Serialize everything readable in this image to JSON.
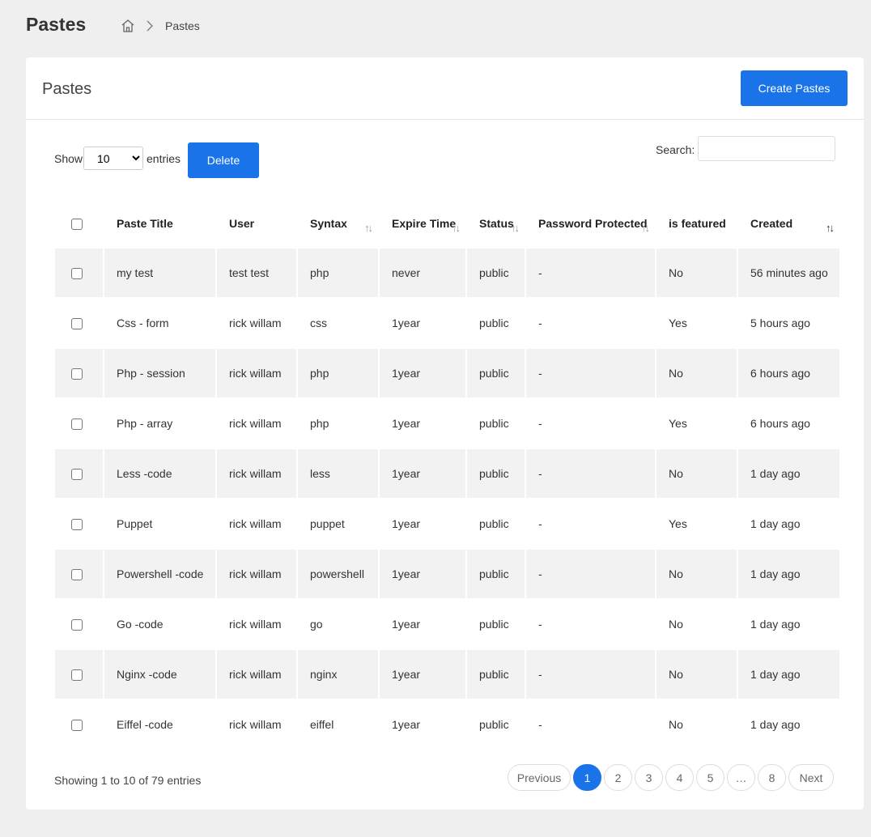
{
  "header": {
    "title": "Pastes",
    "breadcrumb_current": "Pastes"
  },
  "card": {
    "title": "Pastes",
    "create_label": "Create Pastes"
  },
  "controls": {
    "show_label": "Show",
    "length_value": "10",
    "entries_label": "entries",
    "delete_label": "Delete",
    "search_label": "Search:",
    "search_value": ""
  },
  "table": {
    "columns": [
      "Paste Title",
      "User",
      "Syntax",
      "Expire Time",
      "Status",
      "Password Protected",
      "is featured",
      "Created"
    ],
    "rows": [
      [
        "my test",
        "test test",
        "php",
        "never",
        "public",
        "-",
        "No",
        "56 minutes ago"
      ],
      [
        "Css - form",
        "rick willam",
        "css",
        "1year",
        "public",
        "-",
        "Yes",
        "5 hours ago"
      ],
      [
        "Php - session",
        "rick willam",
        "php",
        "1year",
        "public",
        "-",
        "No",
        "6 hours ago"
      ],
      [
        "Php - array",
        "rick willam",
        "php",
        "1year",
        "public",
        "-",
        "Yes",
        "6 hours ago"
      ],
      [
        "Less -code",
        "rick willam",
        "less",
        "1year",
        "public",
        "-",
        "No",
        "1 day ago"
      ],
      [
        "Puppet",
        "rick willam",
        "puppet",
        "1year",
        "public",
        "-",
        "Yes",
        "1 day ago"
      ],
      [
        "Powershell -code",
        "rick willam",
        "powershell",
        "1year",
        "public",
        "-",
        "No",
        "1 day ago"
      ],
      [
        "Go -code",
        "rick willam",
        "go",
        "1year",
        "public",
        "-",
        "No",
        "1 day ago"
      ],
      [
        "Nginx -code",
        "rick willam",
        "nginx",
        "1year",
        "public",
        "-",
        "No",
        "1 day ago"
      ],
      [
        "Eiffel -code",
        "rick willam",
        "eiffel",
        "1year",
        "public",
        "-",
        "No",
        "1 day ago"
      ]
    ]
  },
  "footer": {
    "info": "Showing 1 to 10 of 79 entries",
    "pagination": [
      "Previous",
      "1",
      "2",
      "3",
      "4",
      "5",
      "…",
      "8",
      "Next"
    ],
    "active_page": "1"
  },
  "colors": {
    "primary": "#1a73e8",
    "stripe": "#f2f2f2",
    "background": "#efefef"
  }
}
